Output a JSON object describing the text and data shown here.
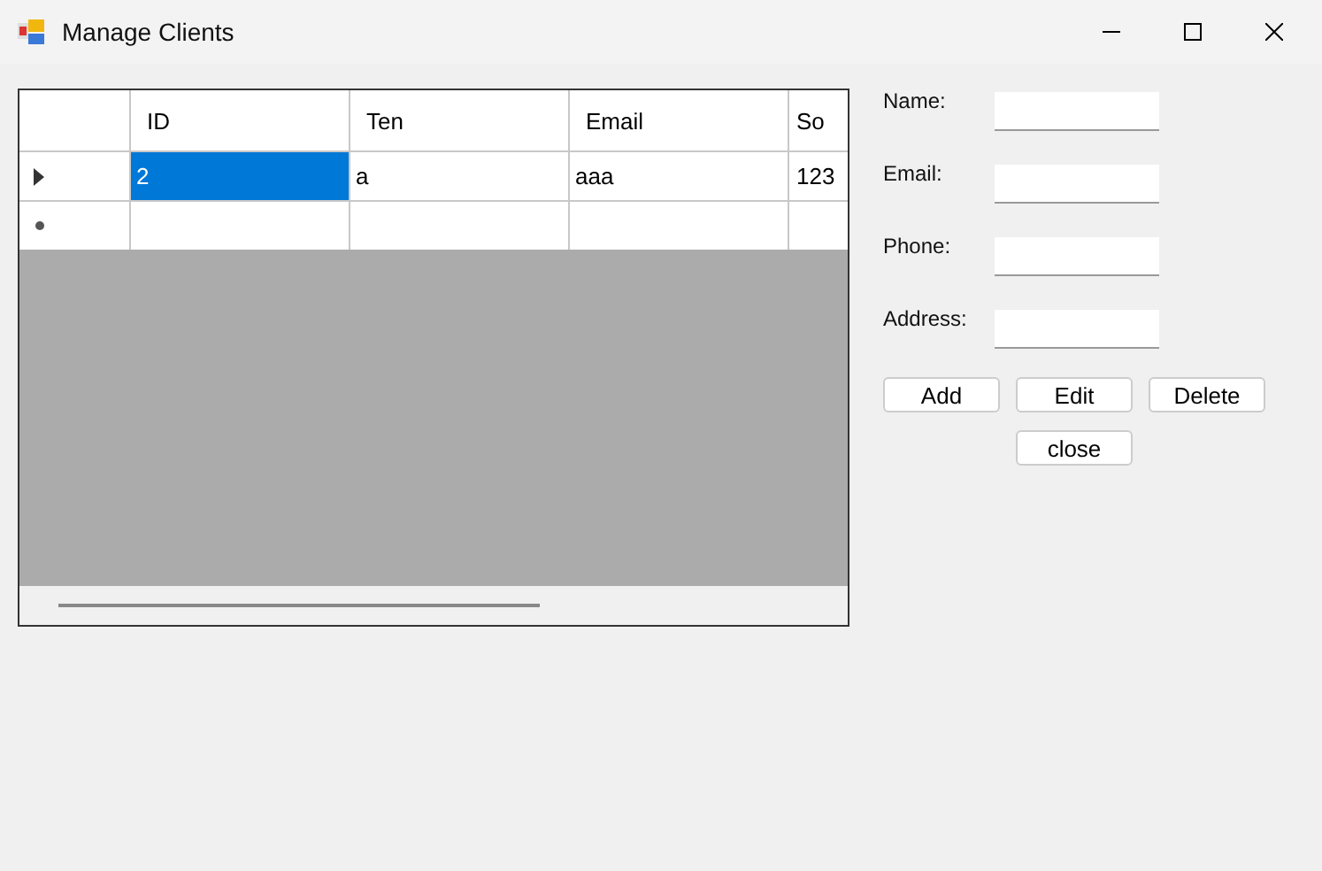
{
  "window": {
    "title": "Manage Clients"
  },
  "grid": {
    "columns": [
      "ID",
      "Ten",
      "Email",
      "So"
    ],
    "rows": [
      {
        "cells": [
          {
            "text": "2",
            "selected": true
          },
          {
            "text": "a",
            "selected": false
          },
          {
            "text": "aaa",
            "selected": false
          },
          {
            "text": "123",
            "selected": false
          }
        ],
        "current": true,
        "new_row": false
      },
      {
        "current": false,
        "new_row": true
      }
    ]
  },
  "form": {
    "fields": [
      {
        "label": "Name:"
      },
      {
        "label": "Email:"
      },
      {
        "label": "Phone:"
      },
      {
        "label": "Address:"
      }
    ],
    "buttons": [
      "Add",
      "Edit",
      "Delete"
    ],
    "close_button": "close"
  }
}
